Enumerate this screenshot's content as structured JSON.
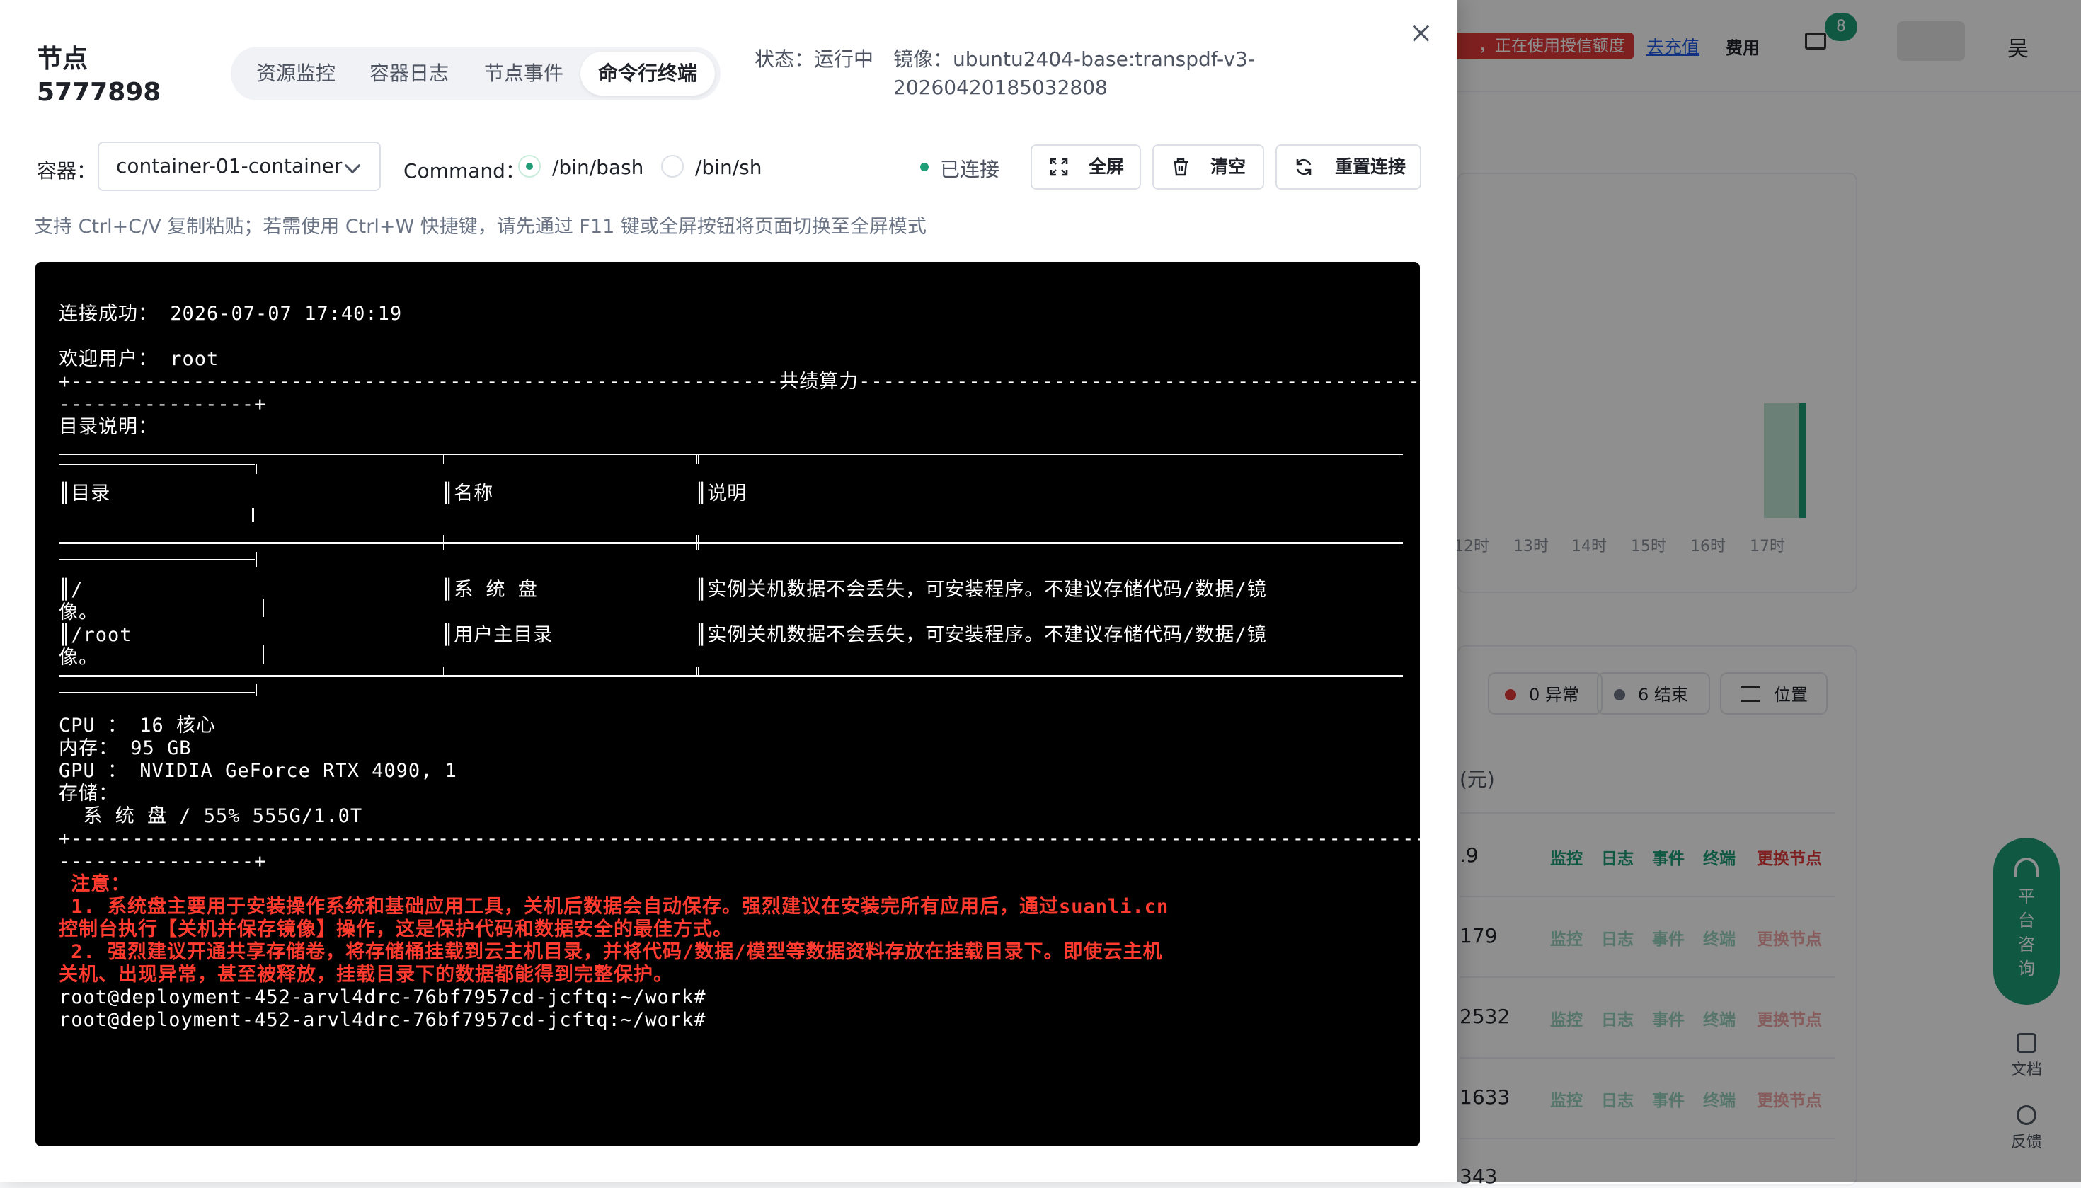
{
  "background": {
    "alert_text": "，正在使用授信额度",
    "recharge_link": "去充值",
    "fee_label": "费用",
    "mail_badge": "8",
    "user_initial": "吴",
    "chart_axis_labels": [
      "12时",
      "13时",
      "14时",
      "15时",
      "16时",
      "17时"
    ],
    "filters": {
      "error": "0 异常",
      "ended": "6 结束",
      "location": "位置"
    },
    "column_fragment": "(元)",
    "row_ids": [
      ".9",
      "179",
      "2532",
      "1633",
      "343"
    ],
    "row_actions": {
      "monitor": "监控",
      "logs": "日志",
      "events": "事件",
      "terminal": "终端",
      "change": "更换节点"
    },
    "help_label": "平台咨询",
    "docs_label": "文档",
    "feedback_label": "反馈"
  },
  "drawer": {
    "title": "节点",
    "node_id": "5777898",
    "tabs": [
      {
        "label": "资源监控"
      },
      {
        "label": "容器日志"
      },
      {
        "label": "节点事件"
      },
      {
        "label": "命令行终端"
      }
    ],
    "status": "状态：运行中",
    "image": "镜像：ubuntu2404-base:transpdf-v3-20260420185032808",
    "container_label": "容器：",
    "container_value": "container-01-container",
    "command_label": "Command：",
    "commands": [
      "/bin/bash",
      "/bin/sh"
    ],
    "connection_status": "已连接",
    "buttons": {
      "fullscreen": "全屏",
      "clear": "清空",
      "reconnect": "重置连接"
    },
    "hint": "支持 Ctrl+C/V 复制粘贴；若需使用 Ctrl+W 快捷键，请先通过 F11 键或全屏按钮将页面切换至全屏模式"
  },
  "terminal": {
    "connected": "连接成功： 2026-07-07 17:40:19",
    "welcome": "欢迎用户： root",
    "banner": "+----------------------------------------------------------共绩算力----------------------------------------------",
    "banner_tail": "----------------+",
    "dir_heading": "目录说明：",
    "table_headers": [
      "║目录",
      "║名称",
      "║说明"
    ],
    "rows": [
      {
        "dir": "║/",
        "name": "║系 统 盘",
        "desc": "║实例关机数据不会丢失，可安装程序。不建议存储代码/数据/镜",
        "wrap": "像。"
      },
      {
        "dir": "║/root",
        "name": "║用户主目录",
        "desc": "║实例关机数据不会丢失，可安装程序。不建议存储代码/数据/镜",
        "wrap": "像。"
      }
    ],
    "cpu": "CPU ： 16 核心",
    "memory": "内存： 95 GB",
    "gpu": "GPU ： NVIDIA GeForce RTX 4090, 1",
    "storage": "存储：",
    "disk": "  系 统 盘 / 55% 555G/1.0T",
    "divider": "+------------------------------------------------------------------------------------------------------------------",
    "divider_tail": "----------------+",
    "notice_title": " 注意：",
    "notice_1a": " 1. 系统盘主要用于安装操作系统和基础应用工具，关机后数据会自动保存。强烈建议在安装完所有应用后，通过suanli.cn",
    "notice_1b": "控制台执行【关机并保存镜像】操作，这是保护代码和数据安全的最佳方式。",
    "notice_2a": " 2. 强烈建议开通共享存储卷，将存储桶挂载到云主机目录，并将代码/数据/模型等数据资料存放在挂载目录下。即使云主机",
    "notice_2b": "关机、出现异常，甚至被释放，挂载目录下的数据都能得到完整保护。",
    "prompt_1": "root@deployment-452-arvl4drc-76bf7957cd-jcftq:~/work#",
    "prompt_2": "root@deployment-452-arvl4drc-76bf7957cd-jcftq:~/work#"
  },
  "colors": {
    "accent": "#1f9e77",
    "danger": "#e23a3a",
    "terminal_bg": "#000000",
    "terminal_notice": "#ff3b30"
  }
}
